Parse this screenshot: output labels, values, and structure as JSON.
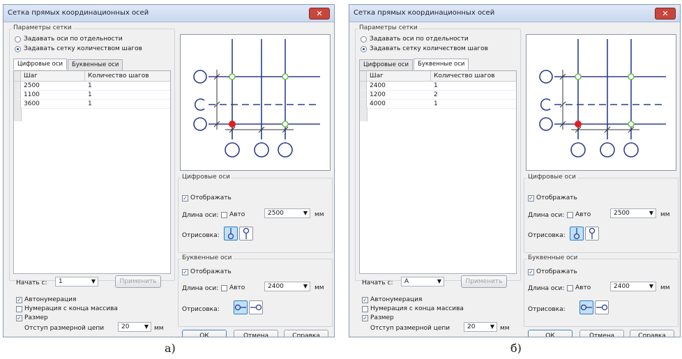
{
  "dialogs": [
    {
      "title": "Сетка прямых координационных осей",
      "close": "✕",
      "grid_params": {
        "legend": "Параметры сетки",
        "radio_separate": "Задавать оси по отдельности",
        "radio_count": "Задавать сетку количеством шагов"
      },
      "tabs": [
        "Цифровые оси",
        "Буквенные оси"
      ],
      "active_tab": 0,
      "table": {
        "headers": [
          "Шаг",
          "Количество шагов"
        ],
        "rows": [
          [
            "2500",
            "1"
          ],
          [
            "1100",
            "1"
          ],
          [
            "3600",
            "1"
          ]
        ]
      },
      "digital": {
        "legend": "Цифровые оси",
        "show": "Отображать",
        "length_label": "Длина оси:",
        "auto": "Авто",
        "length_value": "2500",
        "unit": "мм",
        "draw_label": "Отрисовка:"
      },
      "letter": {
        "legend": "Буквенные оси",
        "show": "Отображать",
        "length_label": "Длина оси:",
        "auto": "Авто",
        "length_value": "2400",
        "unit": "мм",
        "draw_label": "Отрисовка:"
      },
      "start": {
        "label": "Начать с:",
        "value": "1",
        "apply": "Применить"
      },
      "options": {
        "autonum": "Автонумерация",
        "from_end": "Нумерация с конца массива",
        "size": "Размер",
        "offset_label": "Отступ размерной цепи",
        "offset_value": "20",
        "offset_unit": "мм"
      },
      "buttons": [
        "ОК",
        "Отмена",
        "Справка"
      ]
    },
    {
      "title": "Сетка прямых координационных осей",
      "close": "✕",
      "grid_params": {
        "legend": "Параметры сетки",
        "radio_separate": "Задавать оси по отдельности",
        "radio_count": "Задавать сетку количеством шагов"
      },
      "tabs": [
        "Цифровые оси",
        "Буквенные оси"
      ],
      "active_tab": 1,
      "table": {
        "headers": [
          "Шаг",
          "Количество шагов"
        ],
        "rows": [
          [
            "2400",
            "1"
          ],
          [
            "1200",
            "2"
          ],
          [
            "4000",
            "1"
          ]
        ]
      },
      "digital": {
        "legend": "Цифровые оси",
        "show": "Отображать",
        "length_label": "Длина оси:",
        "auto": "Авто",
        "length_value": "2500",
        "unit": "мм",
        "draw_label": "Отрисовка:"
      },
      "letter": {
        "legend": "Буквенные оси",
        "show": "Отображать",
        "length_label": "Длина оси:",
        "auto": "Авто",
        "length_value": "2400",
        "unit": "мм",
        "draw_label": "Отрисовка:"
      },
      "start": {
        "label": "Начать с:",
        "value": "A",
        "apply": "Применить"
      },
      "options": {
        "autonum": "Автонумерация",
        "from_end": "Нумерация с конца массива",
        "size": "Размер",
        "offset_label": "Отступ размерной цепи",
        "offset_value": "20",
        "offset_unit": "мм"
      },
      "buttons": [
        "ОК",
        "Отмена",
        "Справка"
      ]
    }
  ],
  "captions": [
    "а)",
    "б)"
  ],
  "colors": {
    "axis": "#2b3d8f",
    "origin": "#e02020",
    "node": "#6cc04a",
    "selected_icon": "#bfe0f7"
  }
}
